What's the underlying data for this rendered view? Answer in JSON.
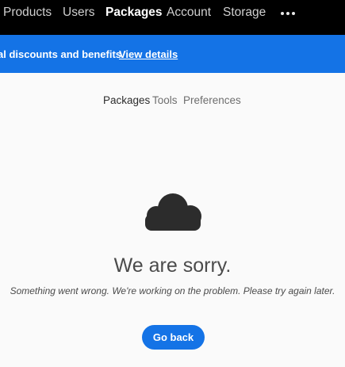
{
  "top_nav": {
    "items": [
      {
        "label": "Products",
        "active": false
      },
      {
        "label": "Users",
        "active": false
      },
      {
        "label": "Packages",
        "active": true
      },
      {
        "label": "Account",
        "active": false
      },
      {
        "label": "Storage",
        "active": false
      }
    ],
    "more_icon": "more-horizontal-icon"
  },
  "banner": {
    "text": "al discounts and benefits.",
    "link_label": "View details",
    "color": "#1473e6"
  },
  "sub_nav": {
    "items": [
      {
        "label": "Packages",
        "active": true
      },
      {
        "label": "Tools",
        "active": false
      },
      {
        "label": "Preferences",
        "active": false
      }
    ]
  },
  "error": {
    "icon": "cloud-icon",
    "title": "We are sorry.",
    "message": "Something went wrong. We're working on the problem. Please try again later.",
    "button_label": "Go back"
  }
}
